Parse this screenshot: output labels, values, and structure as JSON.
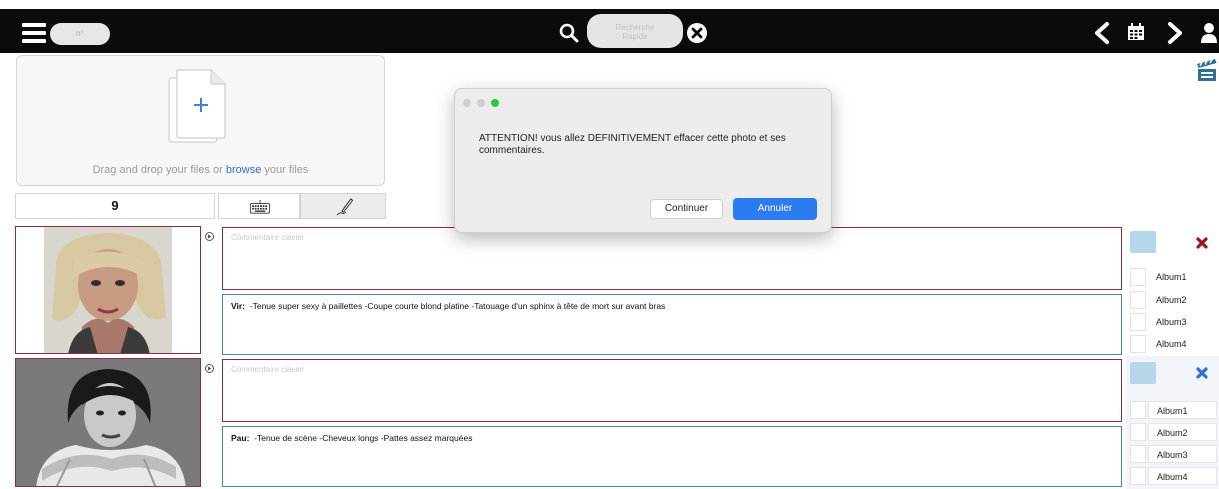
{
  "topbar": {
    "number_placeholder": "n°",
    "search_placeholder_line1": "Recherche",
    "search_placeholder_line2": "Rapide"
  },
  "dropzone": {
    "text_before": "Drag and drop your files or ",
    "link": "browse",
    "text_after": " your files"
  },
  "counter": {
    "value": "9"
  },
  "entries": [
    {
      "comment_placeholder": "Commentaire clavier",
      "author": "Vir:",
      "note": "-Tenue super sexy à paillettes -Coupe courte blond platine -Tatouage d'un sphinx à tête de mort sur avant bras",
      "delete_icon": "red-x-icon",
      "albums": [
        "Album1",
        "Album2",
        "Album3",
        "Album4"
      ]
    },
    {
      "comment_placeholder": "Commentaire clavier",
      "author": "Pau:",
      "note": "-Tenue de scène -Cheveux longs -Pattes assez marquées",
      "delete_icon": "blue-x-icon",
      "albums": [
        "Album1",
        "Album2",
        "Album3",
        "Album4"
      ]
    }
  ],
  "modal": {
    "message": "ATTENTION! vous allez DEFINITIVEMENT effacer cette photo et ses commentaires.",
    "continue_label": "Continuer",
    "cancel_label": "Annuler"
  },
  "colors": {
    "topbar": "#0b0b0b",
    "keyboard_border": "#8b2b45",
    "pen_border": "#3d8ea2",
    "swatch": "#b6d6ea",
    "delete_red": "#a0151b",
    "delete_blue": "#2f6fd6",
    "primary_button": "#2a7cf0"
  }
}
